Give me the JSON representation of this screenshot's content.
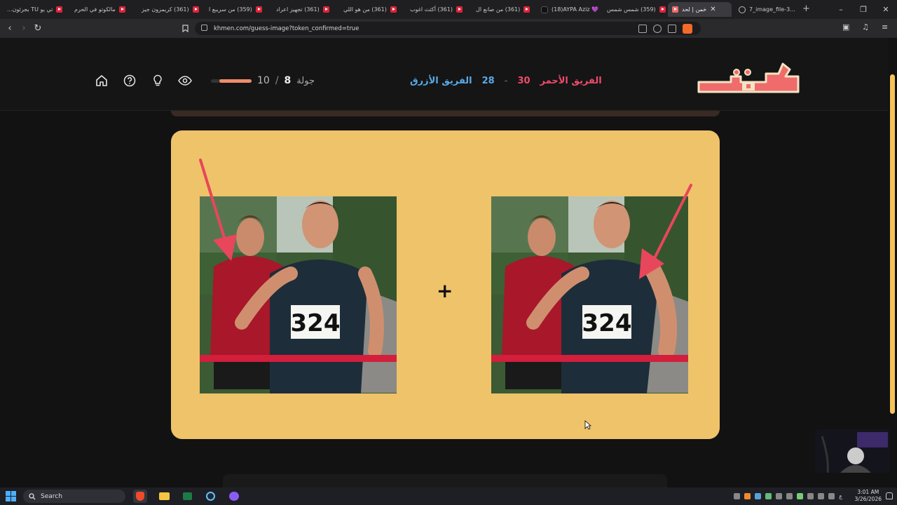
{
  "browser": {
    "tabs": [
      {
        "title": "تي يو TU بجرئون..."
      },
      {
        "title": "مالكوتو في الحرم"
      },
      {
        "title": "(361) كريمزون جيز"
      },
      {
        "title": "(359) من سريبع ا"
      },
      {
        "title": "(361) تجهيز اعراد"
      },
      {
        "title": "(361) من هو اللي"
      },
      {
        "title": "(361) أكثث اغوب"
      },
      {
        "title": "(361) من صانع ال"
      },
      {
        "title": "(18)AYPA Aziz 💜"
      },
      {
        "title": "(359) شمس شمس"
      },
      {
        "title": "خمن | لحد"
      },
      {
        "title": "7_image_file-3..."
      }
    ],
    "url": "khmen.com/guess-image?token_confirmed=true"
  },
  "header": {
    "round_label": "جولة",
    "round_current": "8",
    "round_separator": "/",
    "round_total": "10",
    "round_progress": 0.8,
    "blue_team": "الفريق الأزرق",
    "blue_score": "28",
    "score_separator": "-",
    "red_team": "الفريق الأحمر",
    "red_score": "30",
    "logo_text": "خمن"
  },
  "game": {
    "plus_symbol": "+",
    "image_left_bib": "324",
    "image_right_bib": "324"
  },
  "taskbar": {
    "search_label": "Search",
    "time": "3:01 AM",
    "date": "3/26/2026",
    "lang": "ع"
  },
  "colors": {
    "card_bg": "#efc369",
    "blue_team": "#5aa9e6",
    "red_team": "#ef4b6b",
    "progress": "#f08c6a",
    "logo": "#f06b6b"
  }
}
